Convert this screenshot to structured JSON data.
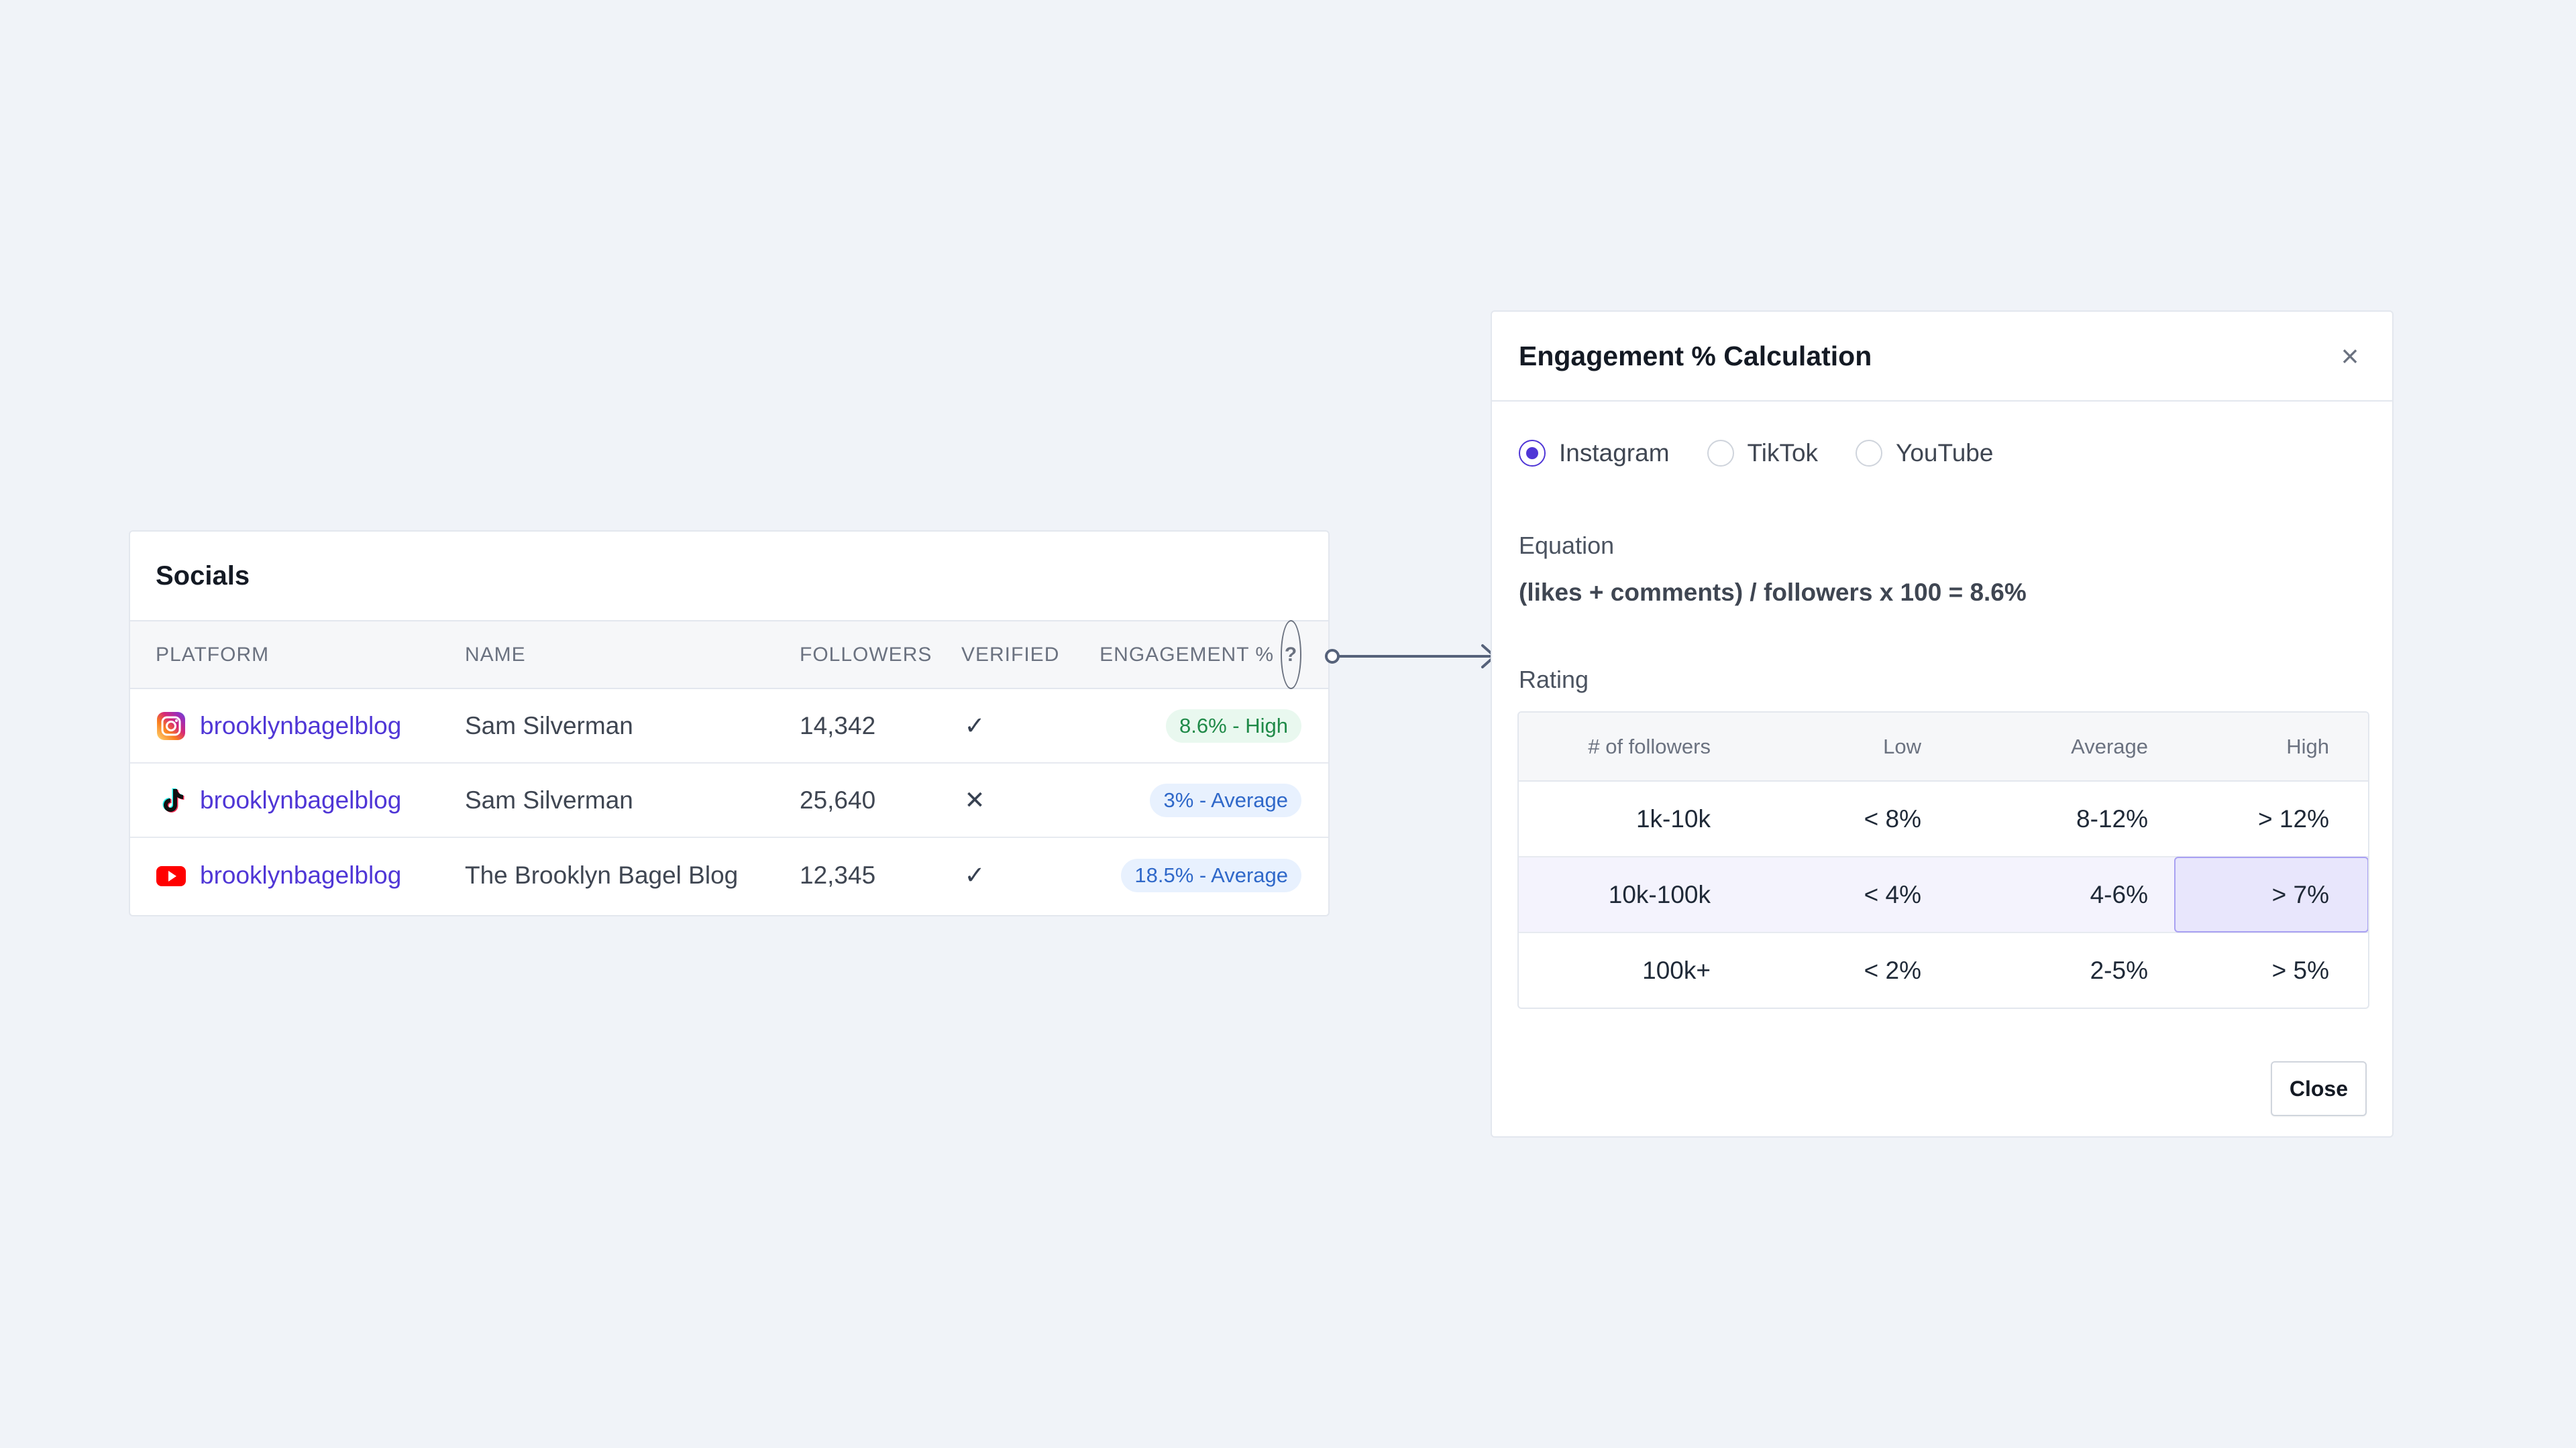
{
  "socials": {
    "title": "Socials",
    "columns": [
      "PLATFORM",
      "NAME",
      "FOLLOWERS",
      "VERIFIED",
      "ENGAGEMENT %"
    ],
    "rows": [
      {
        "platform": "instagram",
        "handle": "brooklynbagelblog",
        "name": "Sam Silverman",
        "followers": "14,342",
        "verified": "✓",
        "engagement": "8.6% - High"
      },
      {
        "platform": "tiktok",
        "handle": "brooklynbagelblog",
        "name": "Sam Silverman",
        "followers": "25,640",
        "verified": "✕",
        "engagement": "3% - Average"
      },
      {
        "platform": "youtube",
        "handle": "brooklynbagelblog",
        "name": "The Brooklyn Bagel Blog",
        "followers": "12,345",
        "verified": "✓",
        "engagement": "18.5% - Average"
      }
    ]
  },
  "modal": {
    "title": "Engagement % Calculation",
    "close_icon": "×",
    "radios": [
      "Instagram",
      "TikTok",
      "YouTube"
    ],
    "selected_radio": "Instagram",
    "equation_label": "Equation",
    "equation": "(likes + comments) / followers x 100 = 8.6%",
    "rating_label": "Rating",
    "rating_columns": [
      "# of followers",
      "Low",
      "Average",
      "High"
    ],
    "rating_rows": [
      [
        "1k-10k",
        "< 8%",
        "8-12%",
        "> 12%"
      ],
      [
        "10k-100k",
        "< 4%",
        "4-6%",
        "> 7%"
      ],
      [
        "100k+",
        "< 2%",
        "2-5%",
        "> 5%"
      ]
    ],
    "close_button": "Close"
  },
  "colors": {
    "accent": "#4f36d6",
    "high_pill_bg": "#e9f8ef",
    "high_pill_text": "#1f8a48",
    "avg_pill_bg": "#e8f1fe",
    "avg_pill_text": "#2f68c9",
    "highlight_cell": "#e8e6fc"
  },
  "icons": {
    "help": "?",
    "instagram": "instagram-icon",
    "tiktok": "tiktok-icon",
    "youtube": "youtube-icon"
  }
}
